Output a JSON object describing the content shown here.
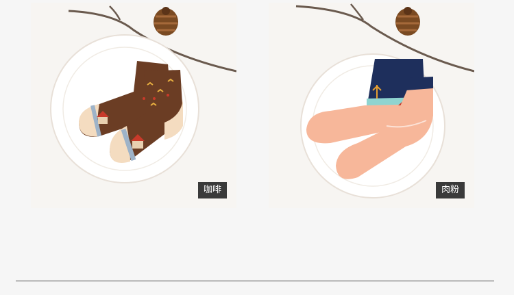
{
  "products": [
    {
      "color_label": "咖啡",
      "sock_color": "#6b3d24",
      "toe_color": "#f4dcc0"
    },
    {
      "color_label": "肉粉",
      "sock_color": "#f7b79a",
      "cuff_color": "#1e2f5c"
    }
  ]
}
